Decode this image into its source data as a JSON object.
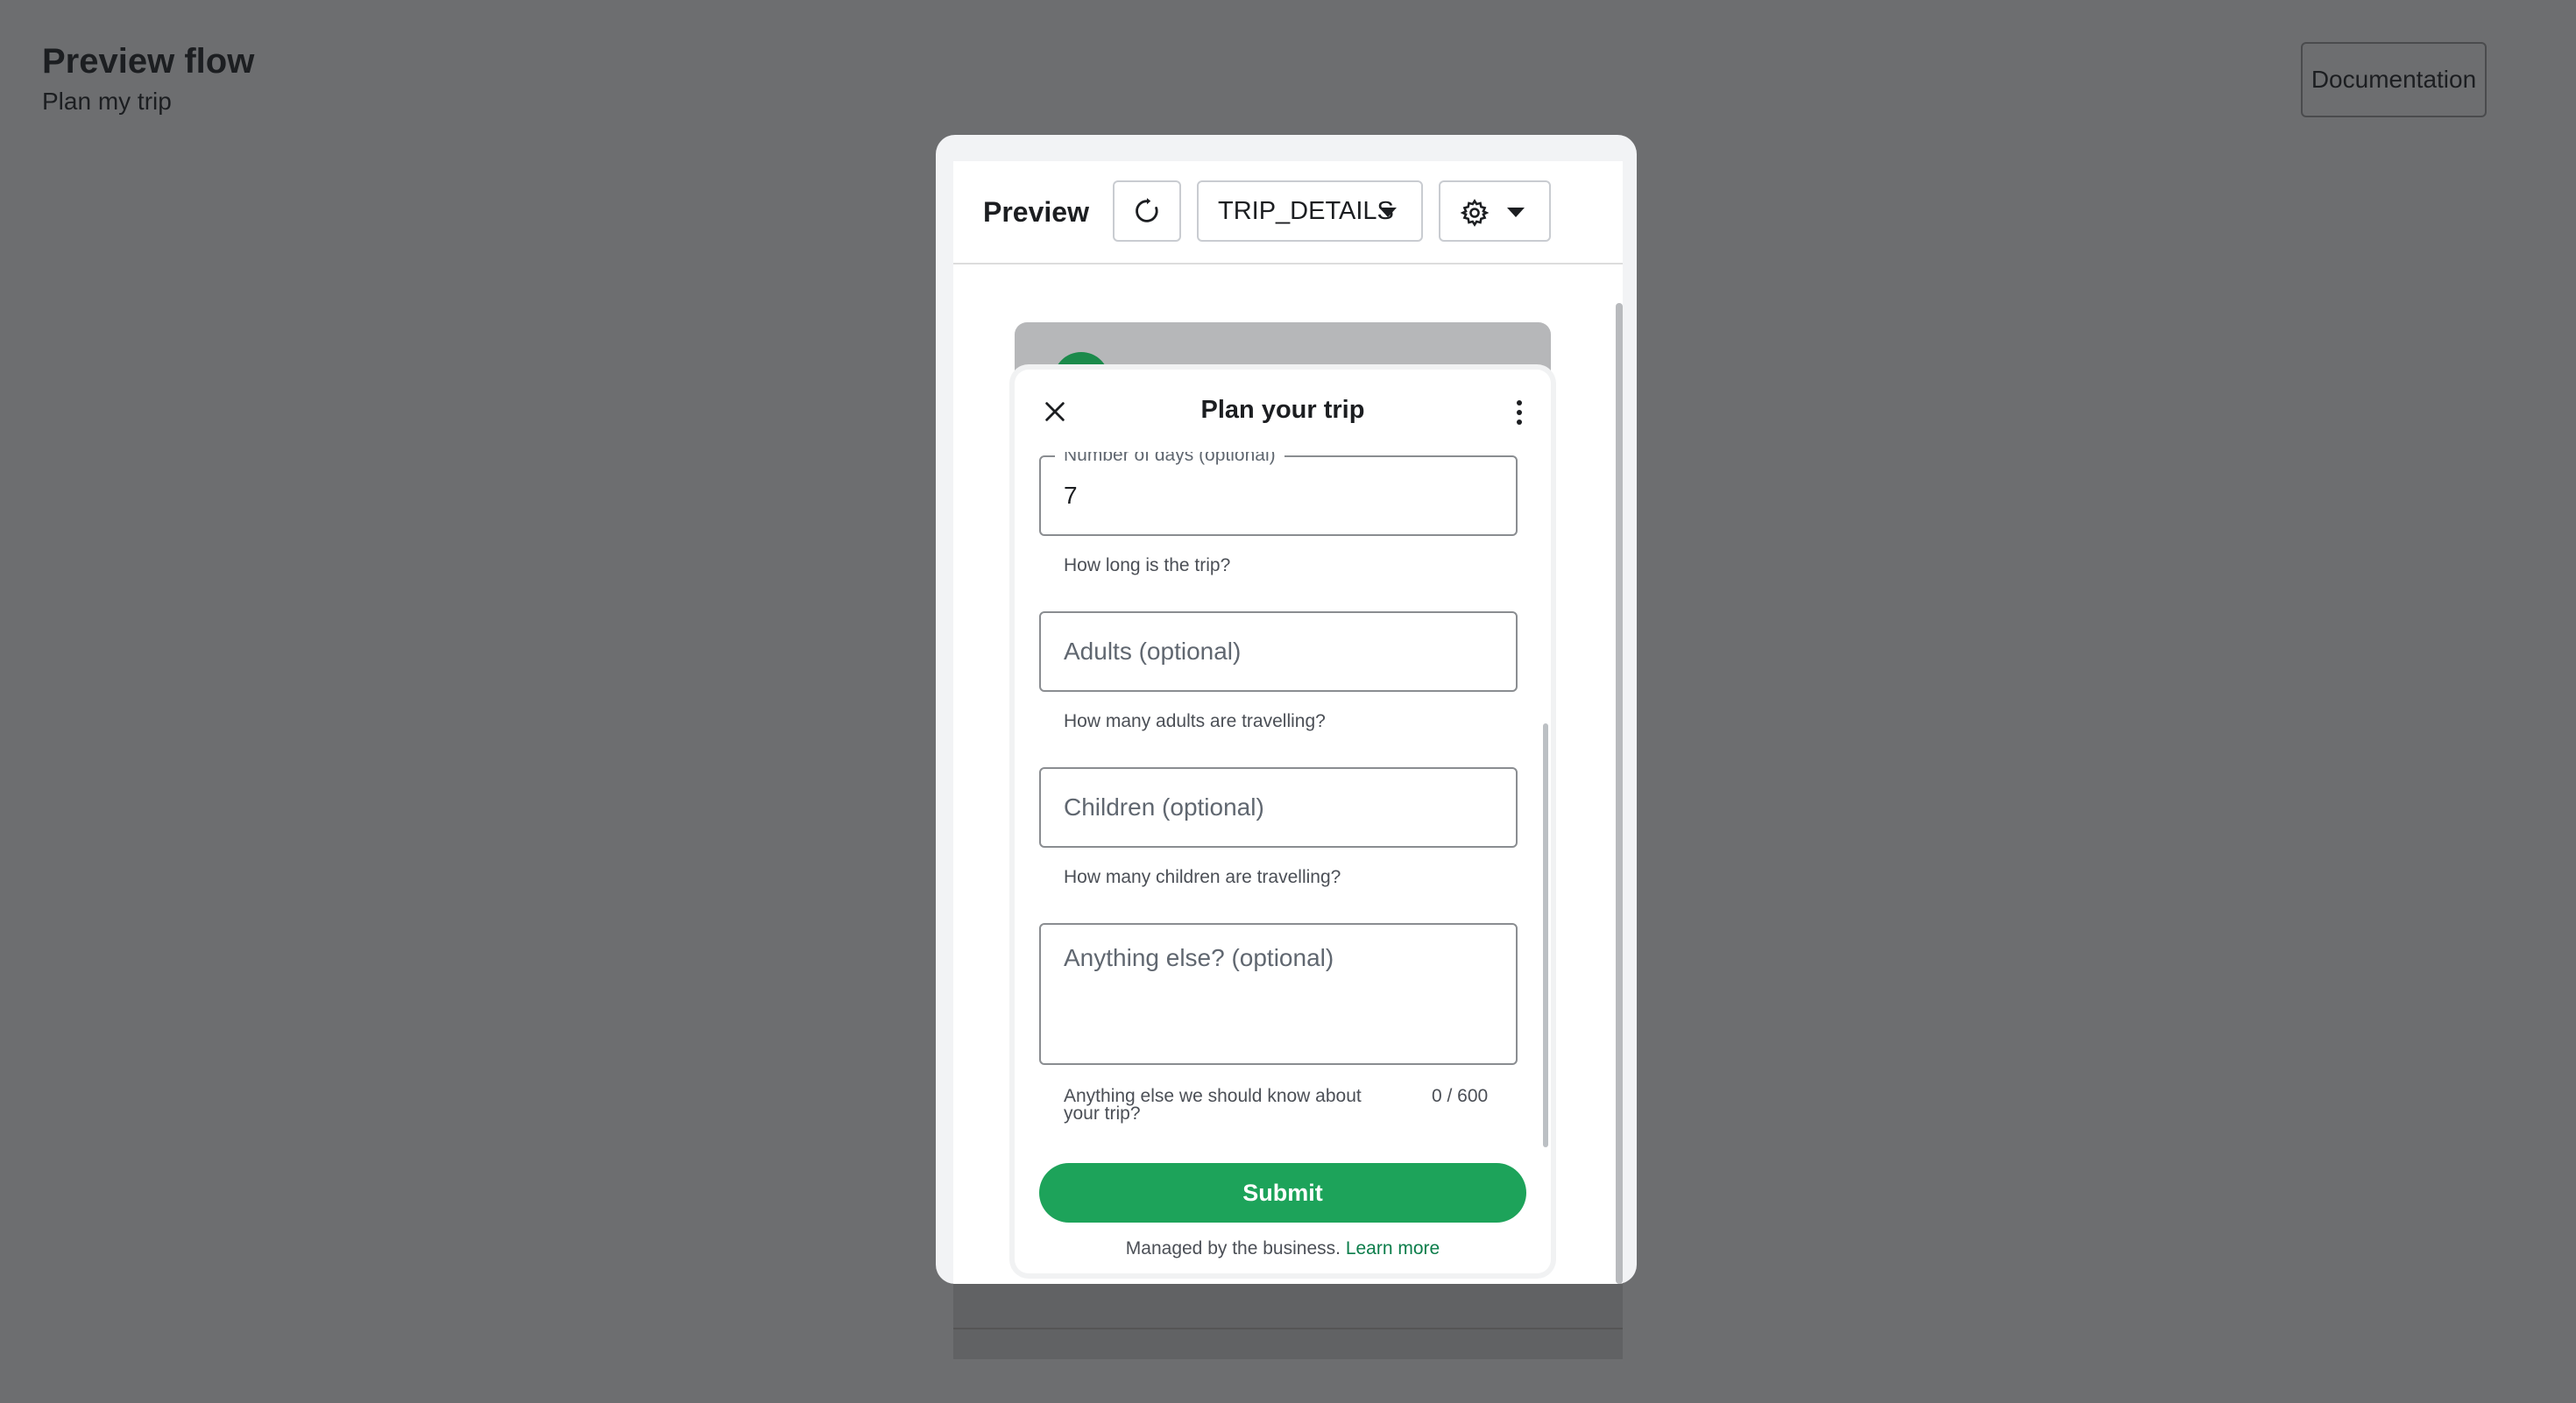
{
  "header": {
    "title": "Preview flow",
    "subtitle": "Plan my trip",
    "documentation_label": "Documentation"
  },
  "toolbar": {
    "preview_label": "Preview",
    "screen_select_value": "TRIP_DETAILS"
  },
  "sheet": {
    "title": "Plan your trip",
    "fields": {
      "days": {
        "label": "Number of days (optional)",
        "value": "7",
        "helper": "How long is the trip?"
      },
      "adults": {
        "placeholder": "Adults (optional)",
        "helper": "How many adults are travelling?"
      },
      "children": {
        "placeholder": "Children (optional)",
        "helper": "How many children are travelling?"
      },
      "anything_else": {
        "placeholder": "Anything else? (optional)",
        "helper_line1": "Anything else we should know about",
        "helper_line2": "your trip?",
        "counter": "0 / 600"
      }
    },
    "submit_label": "Submit",
    "footer": {
      "text": "Managed by the business.",
      "link": "Learn more"
    }
  },
  "colors": {
    "backdrop": "#6d6e70",
    "accent_green": "#1da35a",
    "link_green": "#0b7d4a"
  },
  "icons": [
    "refresh-icon",
    "chevron-down-icon",
    "gear-icon",
    "close-icon",
    "more-vertical-icon"
  ]
}
